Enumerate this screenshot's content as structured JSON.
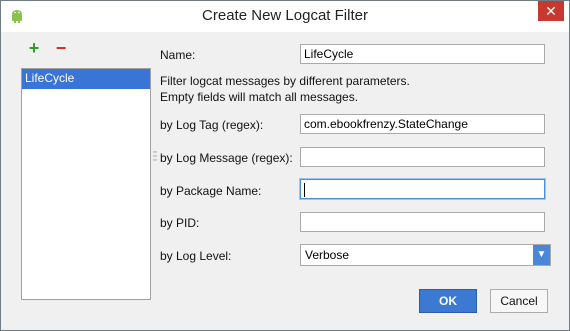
{
  "window": {
    "title": "Create New Logcat Filter",
    "close_symbol": "✕"
  },
  "toolbar": {
    "add_symbol": "+",
    "remove_symbol": "−"
  },
  "filters": {
    "items": [
      {
        "label": "LifeCycle"
      }
    ]
  },
  "form": {
    "name_label": "Name:",
    "name_value": "LifeCycle",
    "description_line1": "Filter logcat messages by different parameters.",
    "description_line2": "Empty fields will match all messages.",
    "tag_label": "by Log Tag (regex):",
    "tag_value": "com.ebookfrenzy.StateChange",
    "message_label": "by Log Message (regex):",
    "message_value": "",
    "package_label": "by Package Name:",
    "package_value": "",
    "pid_label": "by PID:",
    "pid_value": "",
    "level_label": "by Log Level:",
    "level_value": "Verbose"
  },
  "buttons": {
    "ok_label": "OK",
    "cancel_label": "Cancel"
  },
  "icons": {
    "app_icon": "android-icon",
    "dropdown_arrow": "chevron-down-icon"
  },
  "colors": {
    "accent": "#3c79d3",
    "selection": "#3875d7",
    "add": "#2e9d2e",
    "remove": "#d32c2c",
    "close": "#c7382e"
  }
}
